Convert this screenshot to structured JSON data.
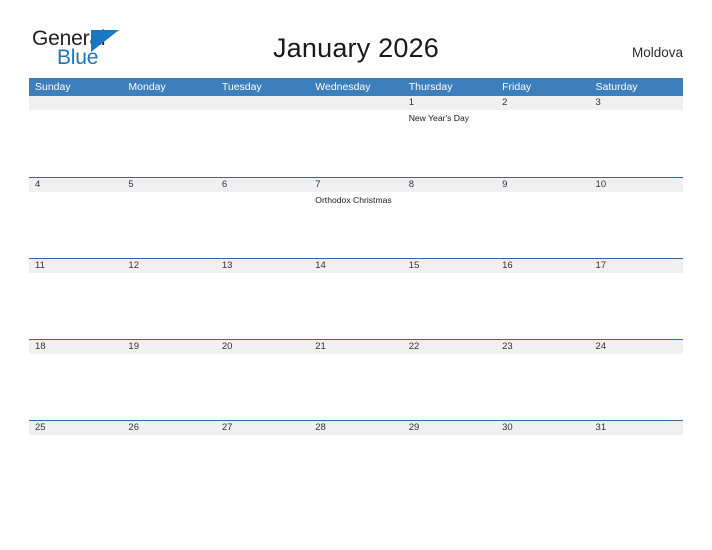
{
  "brand": {
    "name_line1": "General",
    "name_line2": "Blue",
    "triangle_color": "#1878c4"
  },
  "header": {
    "title": "January 2026",
    "country": "Moldova"
  },
  "calendar": {
    "month": "January",
    "year": "2026",
    "header_bg": "#3d7ebd",
    "row_band_bg": "#f0f0f0",
    "row_rule_color": "#2e6ca4",
    "weekday_headers": [
      "Sunday",
      "Monday",
      "Tuesday",
      "Wednesday",
      "Thursday",
      "Friday",
      "Saturday"
    ],
    "weeks": [
      {
        "days": [
          {
            "date": "",
            "event": ""
          },
          {
            "date": "",
            "event": ""
          },
          {
            "date": "",
            "event": ""
          },
          {
            "date": "",
            "event": ""
          },
          {
            "date": "1",
            "event": "New Year's Day"
          },
          {
            "date": "2",
            "event": ""
          },
          {
            "date": "3",
            "event": ""
          }
        ]
      },
      {
        "days": [
          {
            "date": "4",
            "event": ""
          },
          {
            "date": "5",
            "event": ""
          },
          {
            "date": "6",
            "event": ""
          },
          {
            "date": "7",
            "event": "Orthodox Christmas"
          },
          {
            "date": "8",
            "event": ""
          },
          {
            "date": "9",
            "event": ""
          },
          {
            "date": "10",
            "event": ""
          }
        ]
      },
      {
        "days": [
          {
            "date": "11",
            "event": ""
          },
          {
            "date": "12",
            "event": ""
          },
          {
            "date": "13",
            "event": ""
          },
          {
            "date": "14",
            "event": ""
          },
          {
            "date": "15",
            "event": ""
          },
          {
            "date": "16",
            "event": ""
          },
          {
            "date": "17",
            "event": ""
          }
        ]
      },
      {
        "days": [
          {
            "date": "18",
            "event": ""
          },
          {
            "date": "19",
            "event": ""
          },
          {
            "date": "20",
            "event": ""
          },
          {
            "date": "21",
            "event": ""
          },
          {
            "date": "22",
            "event": ""
          },
          {
            "date": "23",
            "event": ""
          },
          {
            "date": "24",
            "event": ""
          }
        ]
      },
      {
        "days": [
          {
            "date": "25",
            "event": ""
          },
          {
            "date": "26",
            "event": ""
          },
          {
            "date": "27",
            "event": ""
          },
          {
            "date": "28",
            "event": ""
          },
          {
            "date": "29",
            "event": ""
          },
          {
            "date": "30",
            "event": ""
          },
          {
            "date": "31",
            "event": ""
          }
        ]
      }
    ]
  }
}
